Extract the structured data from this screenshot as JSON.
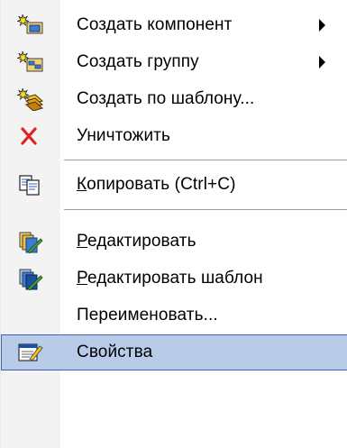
{
  "menu": {
    "items": [
      {
        "label": "Создать компонент",
        "icon": "new-component-icon",
        "submenu": true
      },
      {
        "label": "Создать группу",
        "icon": "new-group-icon",
        "submenu": true
      },
      {
        "label": "Создать по шаблону...",
        "icon": "create-from-template-icon",
        "submenu": false
      },
      {
        "label": "Уничтожить",
        "icon": "delete-x-icon",
        "submenu": false
      },
      {
        "label": "Копировать (Ctrl+C)",
        "icon": "copy-icon",
        "submenu": false
      },
      {
        "label": "Редактировать",
        "icon": "edit-icon",
        "submenu": false
      },
      {
        "label": "Редактировать шаблон",
        "icon": "edit-template-icon",
        "submenu": false
      },
      {
        "label": "Переименовать...",
        "icon": "",
        "submenu": false
      },
      {
        "label": "Свойства",
        "icon": "properties-icon",
        "submenu": false,
        "highlighted": true
      }
    ]
  },
  "colors": {
    "highlight": "#b8cbe8",
    "highlight_border": "#3b64b4",
    "delete_red": "#e02020"
  }
}
